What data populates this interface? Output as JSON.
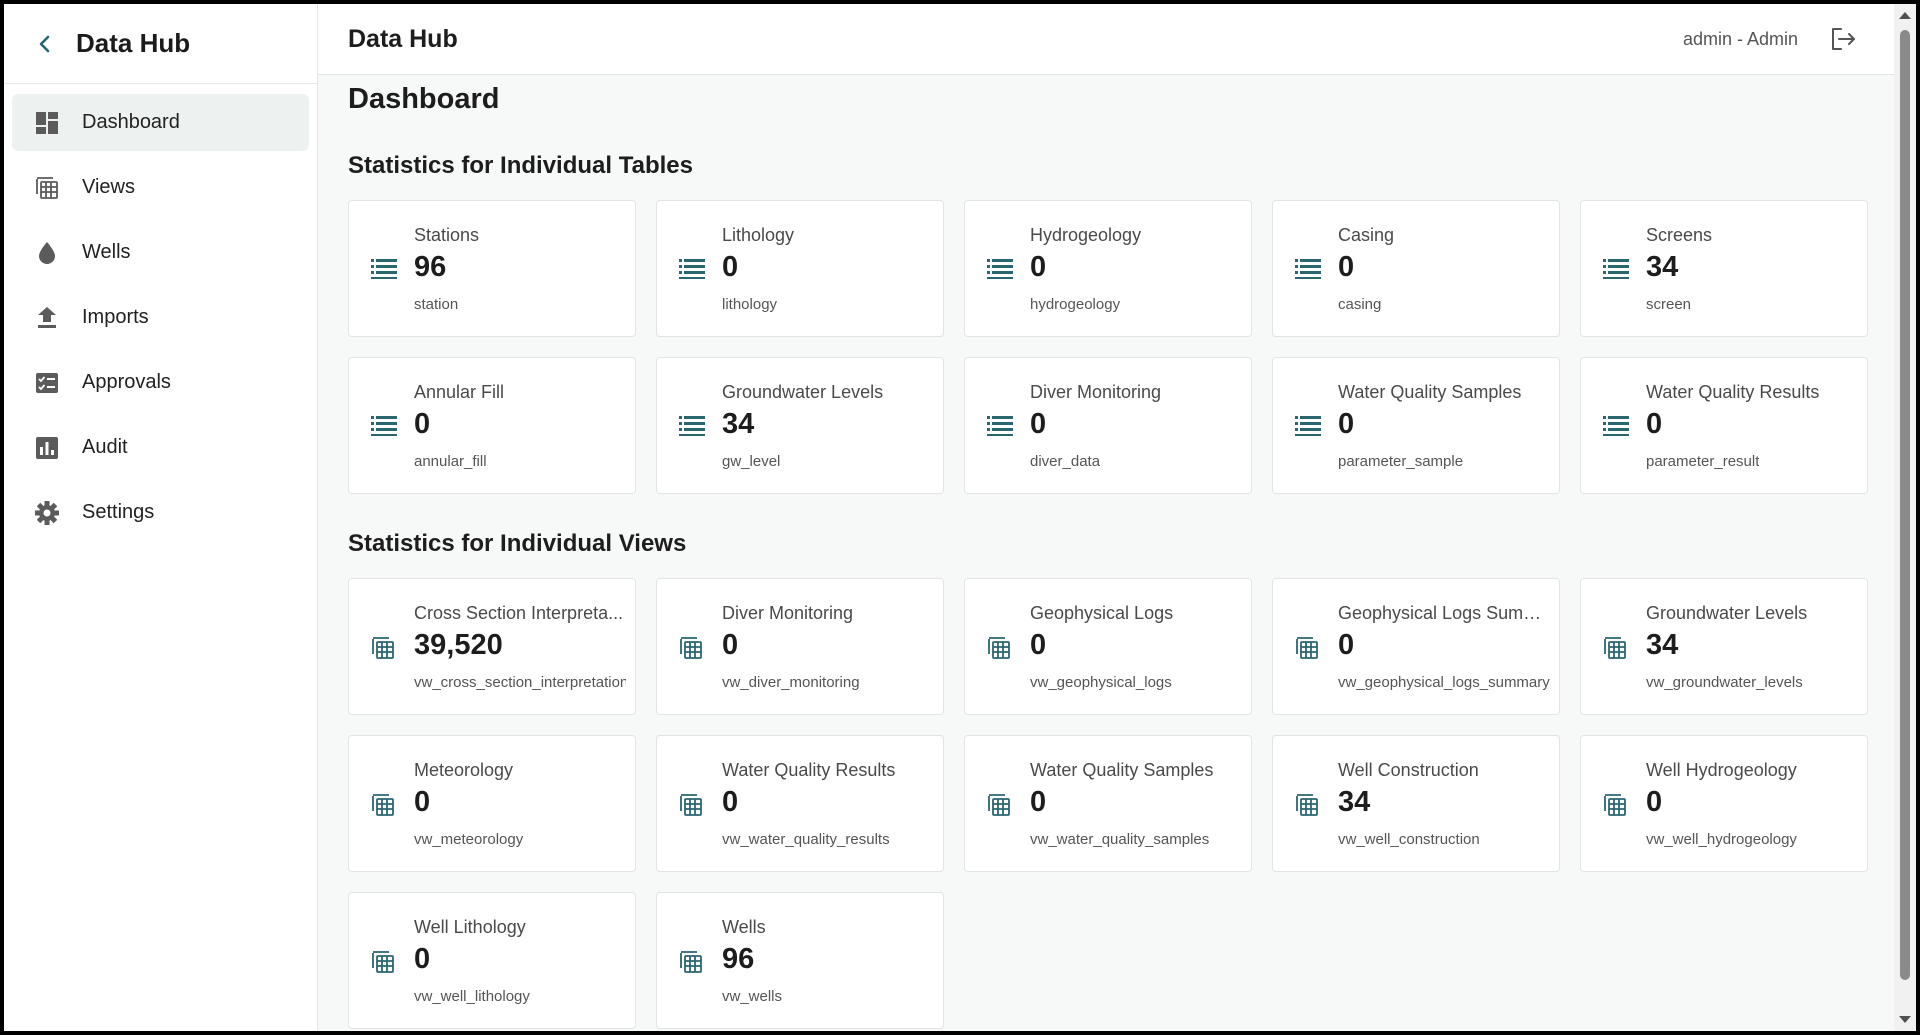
{
  "app": {
    "title": "Data Hub"
  },
  "sidebar": {
    "items": [
      {
        "label": "Dashboard",
        "icon": "dashboard-icon",
        "active": true
      },
      {
        "label": "Views",
        "icon": "views-icon",
        "active": false
      },
      {
        "label": "Wells",
        "icon": "drop-icon",
        "active": false
      },
      {
        "label": "Imports",
        "icon": "upload-icon",
        "active": false
      },
      {
        "label": "Approvals",
        "icon": "approval-icon",
        "active": false
      },
      {
        "label": "Audit",
        "icon": "bar-chart-icon",
        "active": false
      },
      {
        "label": "Settings",
        "icon": "gear-icon",
        "active": false
      }
    ]
  },
  "topbar": {
    "title": "Data Hub",
    "user": "admin - Admin"
  },
  "main": {
    "page_title": "Dashboard",
    "tables_section": {
      "title": "Statistics for Individual Tables",
      "cards": [
        {
          "name": "Stations",
          "count": "96",
          "key": "station"
        },
        {
          "name": "Lithology",
          "count": "0",
          "key": "lithology"
        },
        {
          "name": "Hydrogeology",
          "count": "0",
          "key": "hydrogeology"
        },
        {
          "name": "Casing",
          "count": "0",
          "key": "casing"
        },
        {
          "name": "Screens",
          "count": "34",
          "key": "screen"
        },
        {
          "name": "Annular Fill",
          "count": "0",
          "key": "annular_fill"
        },
        {
          "name": "Groundwater Levels",
          "count": "34",
          "key": "gw_level"
        },
        {
          "name": "Diver Monitoring",
          "count": "0",
          "key": "diver_data"
        },
        {
          "name": "Water Quality Samples",
          "count": "0",
          "key": "parameter_sample"
        },
        {
          "name": "Water Quality Results",
          "count": "0",
          "key": "parameter_result"
        }
      ]
    },
    "views_section": {
      "title": "Statistics for Individual Views",
      "cards": [
        {
          "name": "Cross Section Interpreta...",
          "count": "39,520",
          "key": "vw_cross_section_interpretation"
        },
        {
          "name": "Diver Monitoring",
          "count": "0",
          "key": "vw_diver_monitoring"
        },
        {
          "name": "Geophysical Logs",
          "count": "0",
          "key": "vw_geophysical_logs"
        },
        {
          "name": "Geophysical Logs Summ...",
          "count": "0",
          "key": "vw_geophysical_logs_summary"
        },
        {
          "name": "Groundwater Levels",
          "count": "34",
          "key": "vw_groundwater_levels"
        },
        {
          "name": "Meteorology",
          "count": "0",
          "key": "vw_meteorology"
        },
        {
          "name": "Water Quality Results",
          "count": "0",
          "key": "vw_water_quality_results"
        },
        {
          "name": "Water Quality Samples",
          "count": "0",
          "key": "vw_water_quality_samples"
        },
        {
          "name": "Well Construction",
          "count": "34",
          "key": "vw_well_construction"
        },
        {
          "name": "Well Hydrogeology",
          "count": "0",
          "key": "vw_well_hydrogeology"
        },
        {
          "name": "Well Lithology",
          "count": "0",
          "key": "vw_well_lithology"
        },
        {
          "name": "Wells",
          "count": "96",
          "key": "vw_wells"
        }
      ]
    }
  },
  "colors": {
    "accent": "#2a6670",
    "icon_gray": "#5b5b5b"
  }
}
